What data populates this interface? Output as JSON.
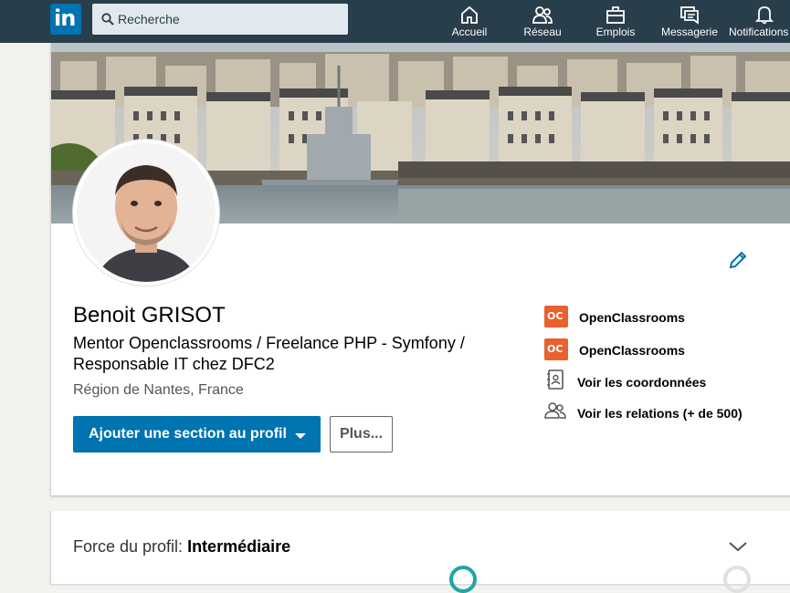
{
  "nav": {
    "logo_text": "in",
    "search_placeholder": "Recherche",
    "items": [
      {
        "label": "Accueil",
        "icon": "home-icon"
      },
      {
        "label": "Réseau",
        "icon": "network-icon"
      },
      {
        "label": "Emplois",
        "icon": "briefcase-icon"
      },
      {
        "label": "Messagerie",
        "icon": "messaging-icon"
      },
      {
        "label": "Notifications",
        "icon": "bell-icon"
      }
    ]
  },
  "profile": {
    "name": "Benoit GRISOT",
    "headline": "Mentor Openclassrooms / Freelance PHP - Symfony / Responsable IT chez DFC2",
    "location": "Région de Nantes, France",
    "add_section_label": "Ajouter une section au profil",
    "more_label": "Plus..."
  },
  "side": {
    "companies": [
      {
        "name": "OpenClassrooms",
        "logo_text": "OC"
      },
      {
        "name": "OpenClassrooms",
        "logo_text": "OC"
      }
    ],
    "contact_label": "Voir les coordonnées",
    "connections_label": "Voir les relations (+ de 500)"
  },
  "strength": {
    "label": "Force du profil: ",
    "value": "Intermédiaire"
  },
  "colors": {
    "nav_bg": "#283e4a",
    "brand": "#0073b1",
    "oc_orange": "#e9612c",
    "teal": "#1fa5a3"
  }
}
